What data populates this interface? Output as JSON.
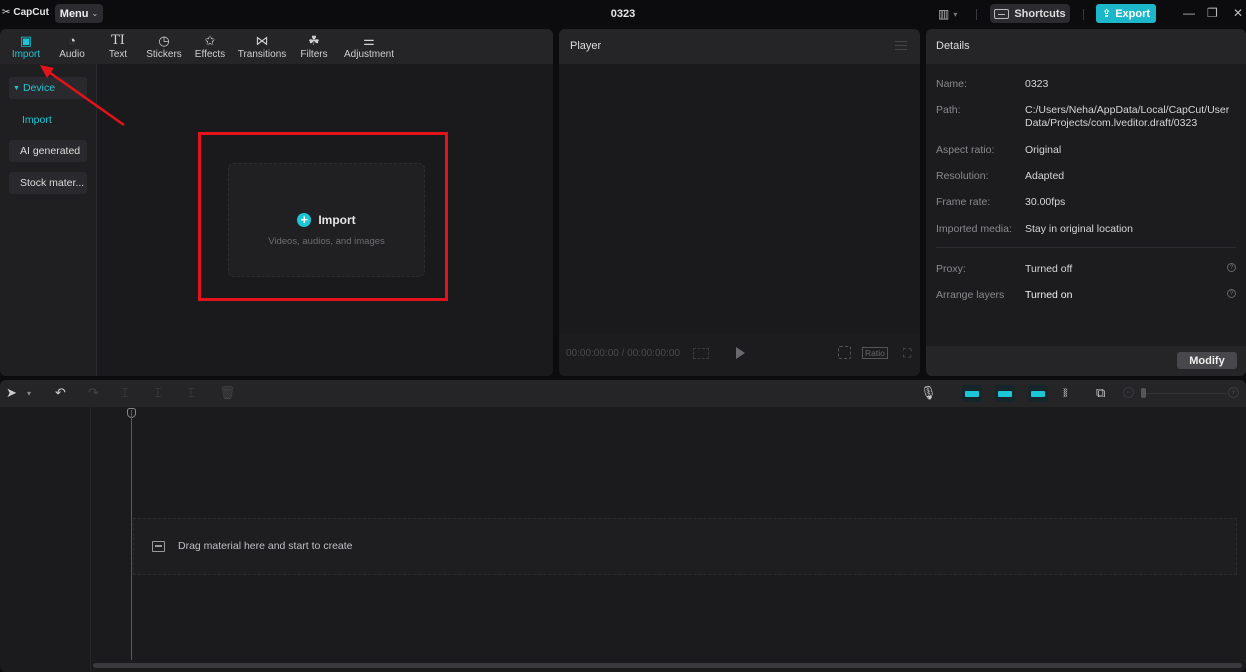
{
  "app": {
    "name": "CapCut",
    "menu_label": "Menu",
    "project_title": "0323"
  },
  "topbar": {
    "shortcuts_label": "Shortcuts",
    "export_label": "Export",
    "accent_color": "#1cb7c8"
  },
  "media_tabs": [
    {
      "label": "Import",
      "icon": "import-icon",
      "active": true
    },
    {
      "label": "Audio",
      "icon": "audio-icon"
    },
    {
      "label": "Text",
      "icon": "text-icon"
    },
    {
      "label": "Stickers",
      "icon": "sticker-icon"
    },
    {
      "label": "Effects",
      "icon": "effects-icon"
    },
    {
      "label": "Transitions",
      "icon": "transitions-icon"
    },
    {
      "label": "Filters",
      "icon": "filters-icon"
    },
    {
      "label": "Adjustment",
      "icon": "adjustment-icon"
    }
  ],
  "sidebar": {
    "device": "Device",
    "import": "Import",
    "ai_generated": "AI generated",
    "stock": "Stock mater..."
  },
  "import_box": {
    "title": "Import",
    "subtitle": "Videos, audios, and images"
  },
  "player": {
    "title": "Player",
    "timecode": "00:00:00:00 / 00:00:00:00",
    "ratio_label": "Ratio"
  },
  "details": {
    "title": "Details",
    "rows": [
      {
        "label": "Name:",
        "value": "0323"
      },
      {
        "label": "Path:",
        "value": "C:/Users/Neha/AppData/Local/CapCut/User Data/Projects/com.lveditor.draft/0323"
      },
      {
        "label": "Aspect ratio:",
        "value": "Original"
      },
      {
        "label": "Resolution:",
        "value": "Adapted"
      },
      {
        "label": "Frame rate:",
        "value": "30.00fps"
      },
      {
        "label": "Imported media:",
        "value": "Stay in original location"
      },
      {
        "label": "Proxy:",
        "value": "Turned off"
      },
      {
        "label": "Arrange layers",
        "value": "Turned on"
      }
    ],
    "modify_label": "Modify"
  },
  "timeline": {
    "empty_hint": "Drag material here and start to create"
  },
  "annotation": {
    "highlight_color": "#e4121a"
  }
}
